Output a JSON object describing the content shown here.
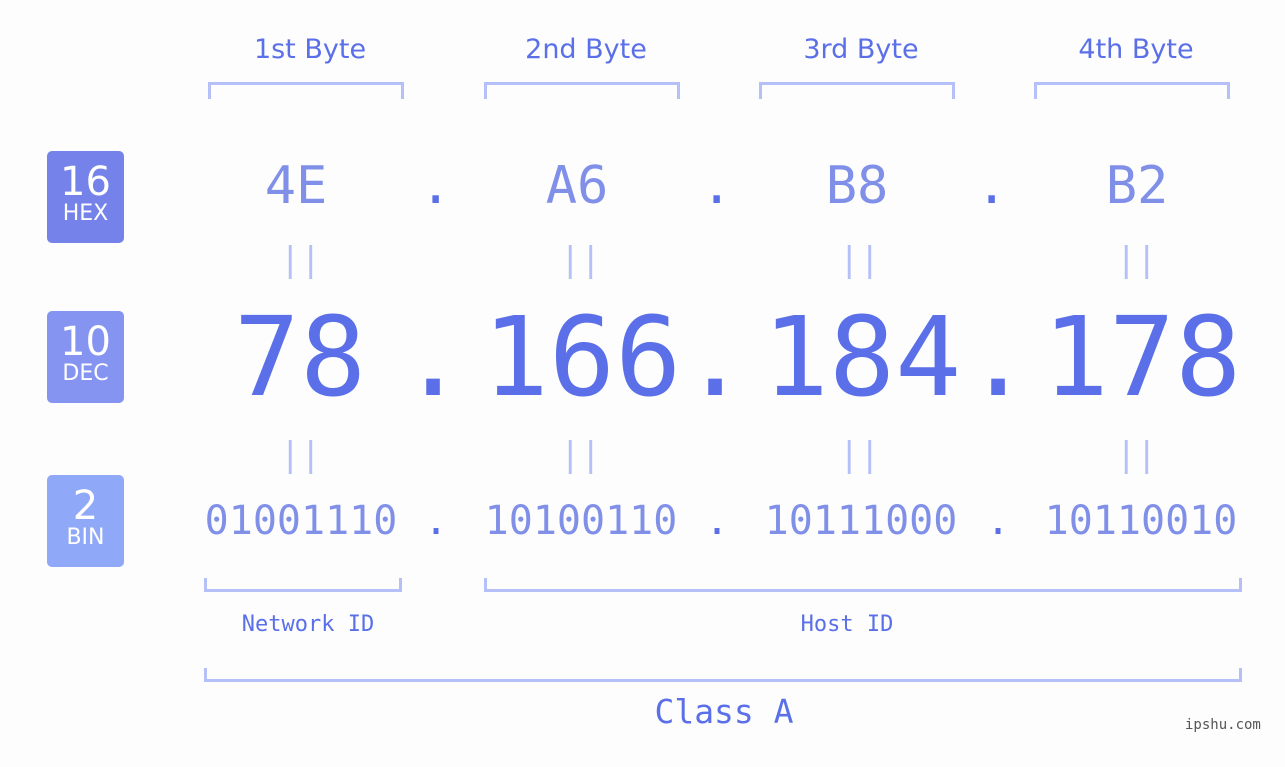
{
  "headers": [
    "1st Byte",
    "2nd Byte",
    "3rd Byte",
    "4th Byte"
  ],
  "badges": [
    {
      "num": "16",
      "label": "HEX",
      "color": "#7482ea"
    },
    {
      "num": "10",
      "label": "DEC",
      "color": "#8494f0"
    },
    {
      "num": "2",
      "label": "BIN",
      "color": "#8fa8f8"
    }
  ],
  "hex": [
    "4E",
    "A6",
    "B8",
    "B2"
  ],
  "dec": [
    "78",
    "166",
    "184",
    "178"
  ],
  "bin": [
    "01001110",
    "10100110",
    "10111000",
    "10110010"
  ],
  "separator": ".",
  "equals": "||",
  "network_label": "Network ID",
  "host_label": "Host ID",
  "class_label": "Class A",
  "footer": "ipshu.com",
  "colors": {
    "primary": "#5a6fe8",
    "secondary": "#8090e8",
    "bracket": "#b5bff8"
  }
}
